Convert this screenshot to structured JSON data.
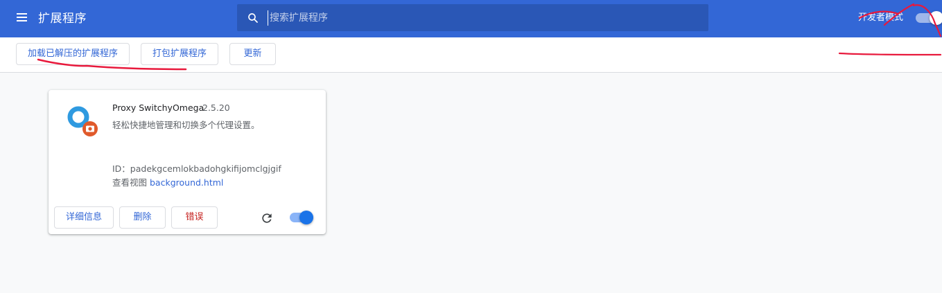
{
  "header": {
    "title": "扩展程序",
    "menu_icon": "menu-icon",
    "search": {
      "placeholder": "搜索扩展程序",
      "value": "",
      "icon": "search-icon"
    },
    "dev_mode": {
      "label": "开发者模式",
      "enabled": true
    }
  },
  "toolbar": {
    "load_unpacked": "加载已解压的扩展程序",
    "pack": "打包扩展程序",
    "update": "更新"
  },
  "extension": {
    "name": "Proxy SwitchyOmega",
    "version": "2.5.20",
    "description": "轻松快捷地管理和切换多个代理设置。",
    "id_text": "ID：padekgcemlokbadohgkifijomclgjgif",
    "views_label": "查看视图",
    "view_link": "background.html",
    "enabled": true,
    "buttons": {
      "details": "详细信息",
      "remove": "删除",
      "errors": "错误"
    }
  },
  "colors": {
    "header_bg": "#3367d6",
    "search_bg": "#2a57b6",
    "link": "#3367d6",
    "error": "#c5221f",
    "annotation": "#e8193c"
  }
}
